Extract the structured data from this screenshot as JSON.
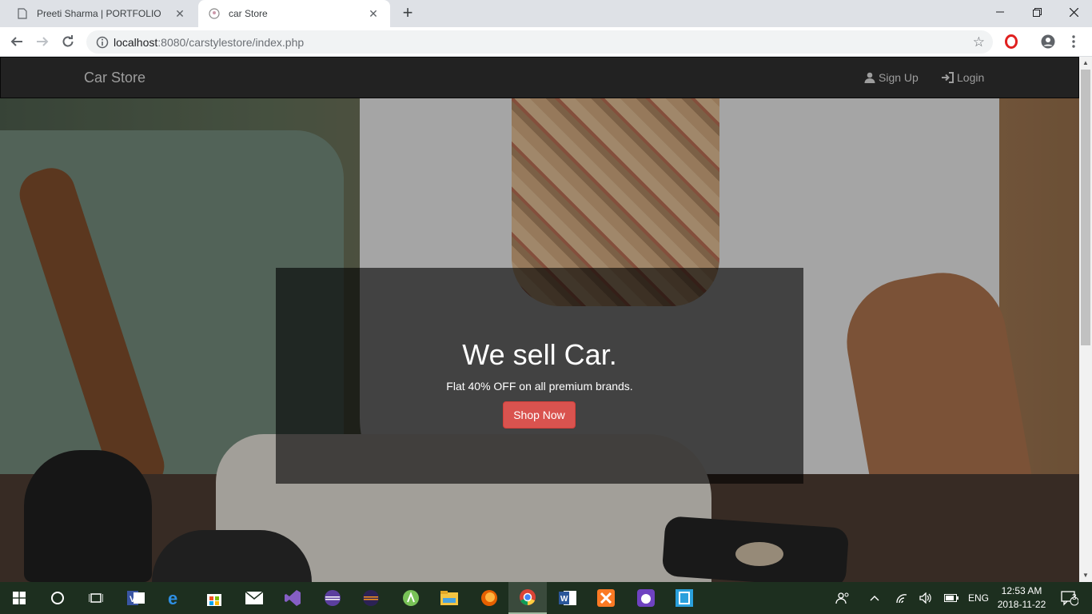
{
  "browser": {
    "tabs": [
      {
        "title": "Preeti Sharma | PORTFOLIO",
        "active": false
      },
      {
        "title": "car Store",
        "active": true
      }
    ],
    "url_host": "localhost",
    "url_rest": ":8080/carstylestore/index.php"
  },
  "site": {
    "brand": "Car Store",
    "nav": {
      "signup": "Sign Up",
      "login": "Login"
    },
    "hero": {
      "title": "We sell Car.",
      "subtitle": "Flat 40% OFF on all premium brands.",
      "button": "Shop Now"
    }
  },
  "taskbar": {
    "language": "ENG",
    "time": "12:53 AM",
    "date": "2018-11-22",
    "notifications": "3"
  },
  "colors": {
    "navbar_bg": "#222222",
    "navbar_text": "#9d9d9d",
    "button_danger": "#d9534f",
    "taskbar_bg": "#1d2f1f"
  }
}
